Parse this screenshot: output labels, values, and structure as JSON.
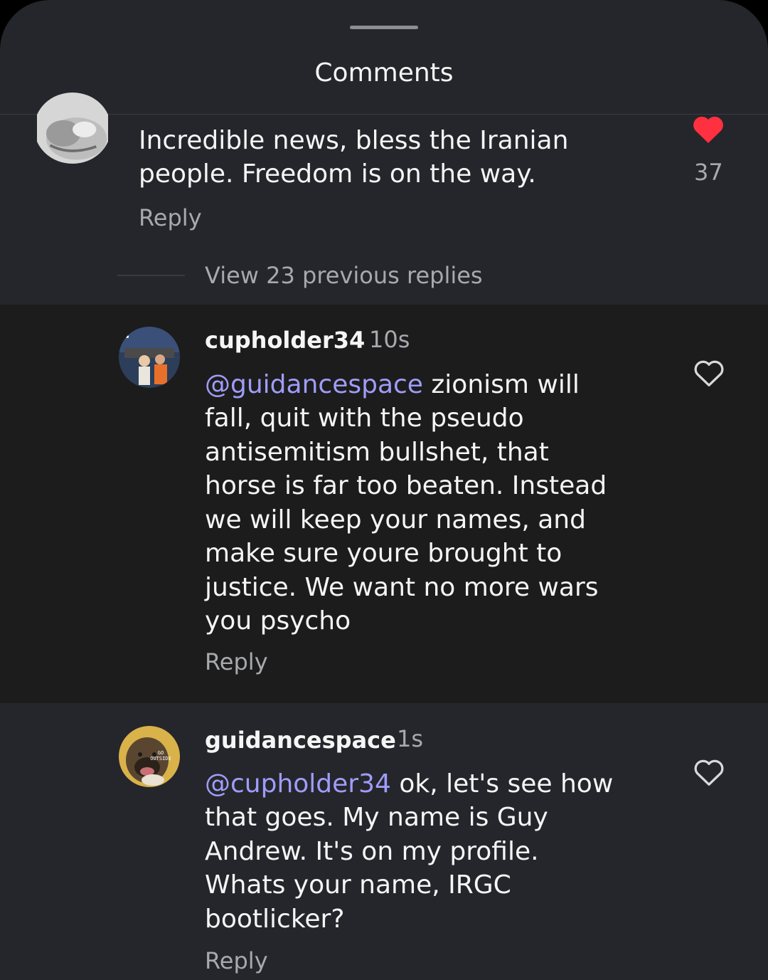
{
  "sheet": {
    "title": "Comments"
  },
  "comment_top": {
    "text_line1": "Incredible news, bless the Iranian",
    "text_line2": "people. Freedom is on the way.",
    "reply": "Reply",
    "likes": "37",
    "liked": true
  },
  "view_replies": "View 23 previous replies",
  "reply_1": {
    "username": "cupholder34",
    "time": "10s",
    "mention": "@guidancespace",
    "lines": [
      " zionism will",
      "fall, quit with the pseudo",
      "antisemitism bullshet, that",
      "horse is far too beaten. Instead",
      "we will keep your names, and",
      "make sure youre brought to",
      "justice. We want no more wars",
      "you psycho"
    ],
    "reply": "Reply"
  },
  "reply_2": {
    "username": "guidancespace",
    "time": "1s",
    "mention": "@cupholder34",
    "lines": [
      " ok, let's see how",
      "that goes. My name is Guy",
      "Andrew. It's on my profile.",
      "Whats your name, IRGC",
      "bootlicker?"
    ],
    "reply": "Reply",
    "avatar_text": "GO OUTSIDE"
  },
  "colors": {
    "sheet_bg": "#25262b",
    "highlight_bg": "#1c1c1c",
    "mention": "#9f9dfa",
    "like_red": "#ff3040",
    "muted_text": "#a8a9ae"
  },
  "icons": [
    "drag-handle",
    "heart-filled-icon",
    "heart-outline-icon"
  ]
}
